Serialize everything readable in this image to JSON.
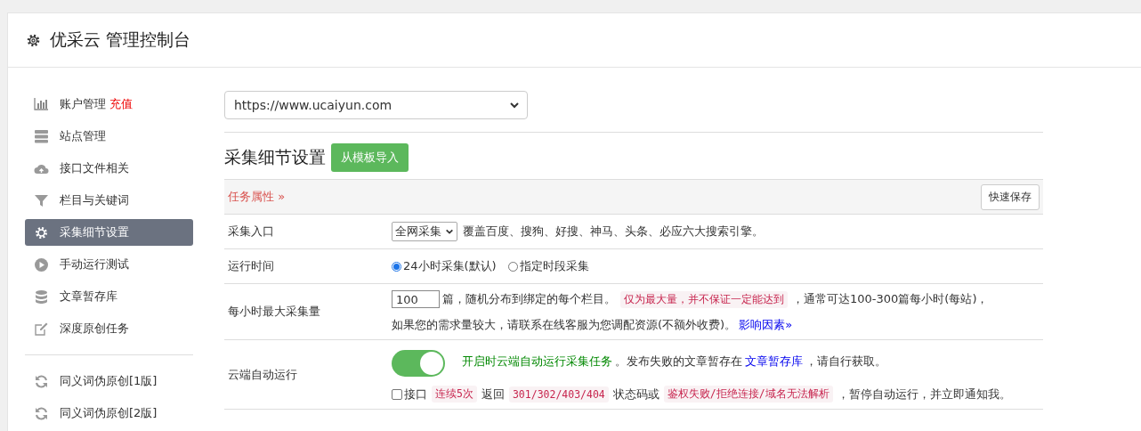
{
  "header": {
    "title": "优采云 管理控制台"
  },
  "sidebar": {
    "groups": [
      {
        "items": [
          {
            "label": "账户管理",
            "badge": "充值",
            "selected": false
          },
          {
            "label": "站点管理",
            "selected": false
          },
          {
            "label": "接口文件相关",
            "selected": false
          },
          {
            "label": "栏目与关键词",
            "selected": false
          },
          {
            "label": "采集细节设置",
            "selected": true
          },
          {
            "label": "手动运行测试",
            "selected": false
          },
          {
            "label": "文章暂存库",
            "selected": false
          },
          {
            "label": "深度原创任务",
            "selected": false
          }
        ]
      },
      {
        "items": [
          {
            "label": "同义词伪原创[1版]",
            "selected": false
          },
          {
            "label": "同义词伪原创[2版]",
            "selected": false
          }
        ]
      }
    ]
  },
  "site_select": {
    "value": "https://www.ucaiyun.com"
  },
  "section": {
    "title": "采集细节设置",
    "button": "从模板导入"
  },
  "table": {
    "header": {
      "label": "任务属性",
      "arrow": "»",
      "button": "快速保存"
    },
    "rows": [
      {
        "label": "采集入口",
        "lines": [
          [
            {
              "kind": "select",
              "text": "全网采集"
            },
            {
              "kind": "text",
              "text": "覆盖百度、搜狗、好搜、神马、头条、必应六大搜索引擎。"
            }
          ]
        ]
      },
      {
        "label": "运行时间",
        "lines": [
          [
            {
              "kind": "radio",
              "text": "24小时采集(默认)",
              "selected": true
            },
            {
              "kind": "radio",
              "text": "指定时段采集",
              "selected": false
            }
          ]
        ]
      },
      {
        "label": "每小时最大采集量",
        "lines": [
          [
            {
              "kind": "input",
              "text": "100"
            },
            {
              "kind": "text",
              "text": "篇，随机分布到绑定的每个栏目。"
            },
            {
              "kind": "code",
              "text": "仅为最大量，并不保证一定能达到"
            },
            {
              "kind": "text",
              "text": "，通常可达100-300篇每小时(每站)，"
            }
          ],
          [
            {
              "kind": "text",
              "text": "如果您的需求量较大，请联系在线客服为您调配资源(不额外收费)。"
            },
            {
              "kind": "link",
              "text": "影响因素»"
            }
          ]
        ]
      },
      {
        "label": "云端自动运行",
        "lines": [
          [
            {
              "kind": "toggle",
              "on": true
            },
            {
              "kind": "green",
              "text": "开启时云端自动运行采集任务"
            },
            {
              "kind": "text",
              "text": "。发布失败的文章暂存在"
            },
            {
              "kind": "link",
              "text": "文章暂存库"
            },
            {
              "kind": "text",
              "text": "，请自行获取。"
            }
          ],
          [
            {
              "kind": "checkbox",
              "text": "接口",
              "checked": false
            },
            {
              "kind": "code",
              "text": "连续5次"
            },
            {
              "kind": "text",
              "text": "返回"
            },
            {
              "kind": "code",
              "text": "301/302/403/404"
            },
            {
              "kind": "text",
              "text": "状态码或"
            },
            {
              "kind": "code",
              "text": "鉴权失败/拒绝连接/域名无法解析"
            },
            {
              "kind": "text",
              "text": "，暂停自动运行，并立即通知我。"
            }
          ]
        ]
      }
    ]
  }
}
